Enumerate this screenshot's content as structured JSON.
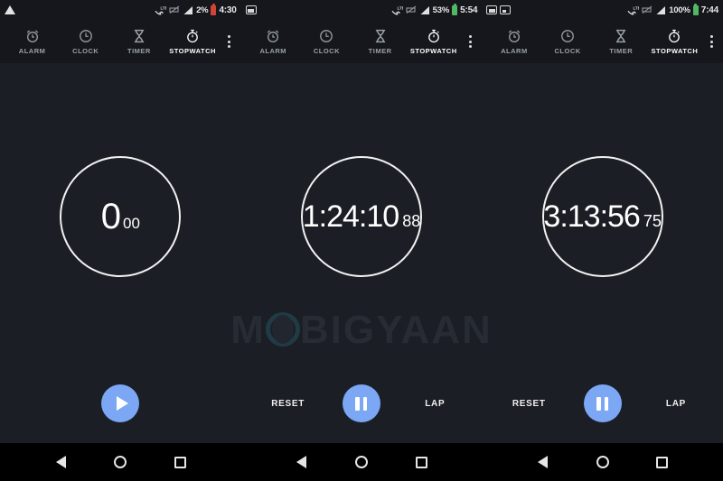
{
  "app": {
    "name": "Clock",
    "screen": "Stopwatch",
    "background_color": "#1b1e24",
    "accent_color": "#7ba7f5"
  },
  "watermark": {
    "text_before": "M",
    "ring": "O",
    "text_after": "BIGYAAN"
  },
  "tabs": [
    {
      "label": "ALARM",
      "icon": "alarm-icon",
      "active": false
    },
    {
      "label": "CLOCK",
      "icon": "clock-icon",
      "active": false
    },
    {
      "label": "TIMER",
      "icon": "hourglass-icon",
      "active": false
    },
    {
      "label": "STOPWATCH",
      "icon": "stopwatch-icon",
      "active": true
    }
  ],
  "overflow_menu": {
    "icon": "more-vert-icon"
  },
  "panels": [
    {
      "status": {
        "left_icons": [
          "warning-triangle-icon"
        ],
        "volte_icon": "volte-phone-icon",
        "mute_icon": "mute-icon",
        "signal_icon": "signal-bars-icon",
        "battery_percent": "2%",
        "battery_state": "low",
        "battery_color": "#d04437",
        "time": "4:30"
      },
      "stopwatch": {
        "main": "0",
        "hundredths": "00",
        "state": "stopped"
      },
      "controls": {
        "layout": "single",
        "left_label": "",
        "right_label": "",
        "fab": "play"
      }
    },
    {
      "status": {
        "left_icons": [
          "screenshot-notification-icon"
        ],
        "volte_icon": "volte-phone-icon",
        "mute_icon": "mute-icon",
        "signal_icon": "signal-bars-icon",
        "battery_percent": "53%",
        "battery_state": "charging",
        "battery_color": "#52b863",
        "time": "5:54"
      },
      "stopwatch": {
        "main": "1:24:10",
        "hundredths": "88",
        "state": "running"
      },
      "controls": {
        "layout": "triple",
        "left_label": "RESET",
        "right_label": "LAP",
        "fab": "pause"
      }
    },
    {
      "status": {
        "left_icons": [
          "screenshot-notification-icon",
          "image-notification-icon"
        ],
        "volte_icon": "volte-phone-icon",
        "mute_icon": "mute-icon",
        "signal_icon": "signal-bars-icon",
        "battery_percent": "100%",
        "battery_state": "full",
        "battery_color": "#52b863",
        "time": "7:44"
      },
      "stopwatch": {
        "main": "3:13:56",
        "hundredths": "75",
        "state": "running"
      },
      "controls": {
        "layout": "triple",
        "left_label": "RESET",
        "right_label": "LAP",
        "fab": "pause"
      }
    }
  ],
  "navbar": {
    "back": "back-icon",
    "home": "home-icon",
    "recents": "recents-icon"
  }
}
